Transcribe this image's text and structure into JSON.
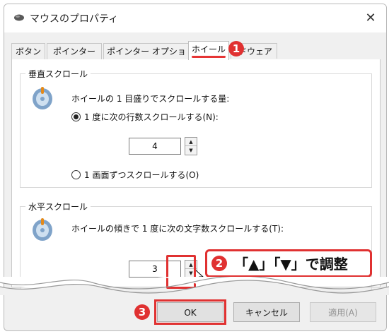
{
  "window": {
    "title": "マウスのプロパティ",
    "close_glyph": "✕"
  },
  "tabs": [
    {
      "label": "ボタン",
      "selected": false
    },
    {
      "label": "ポインター",
      "selected": false
    },
    {
      "label": "ポインター オプション",
      "selected": false
    },
    {
      "label": "ホイール",
      "selected": true
    },
    {
      "label": "ドウェア",
      "selected": false
    }
  ],
  "vertical_scroll": {
    "group_title": "垂直スクロール",
    "description": "ホイールの 1 目盛りでスクロールする量:",
    "option_lines": {
      "label": "1 度に次の行数スクロールする(N):",
      "checked": true
    },
    "lines_value": "4",
    "option_screen": {
      "label": "1 画面ずつスクロールする(O)",
      "checked": false
    }
  },
  "horizontal_scroll": {
    "group_title": "水平スクロール",
    "description": "ホイールの傾きで 1 度に次の文字数スクロールする(T):",
    "chars_value": "3"
  },
  "spinner": {
    "up_glyph": "▲",
    "down_glyph": "▼"
  },
  "callouts": {
    "step1": "1",
    "step2": "2",
    "step2_text": "「▲」「▼」で調整",
    "step3": "3"
  },
  "buttons": {
    "ok": "OK",
    "cancel": "キャンセル",
    "apply": "適用(A)"
  },
  "colors": {
    "accent_red": "#e03131",
    "panel_bg": "#f0f0f0"
  }
}
